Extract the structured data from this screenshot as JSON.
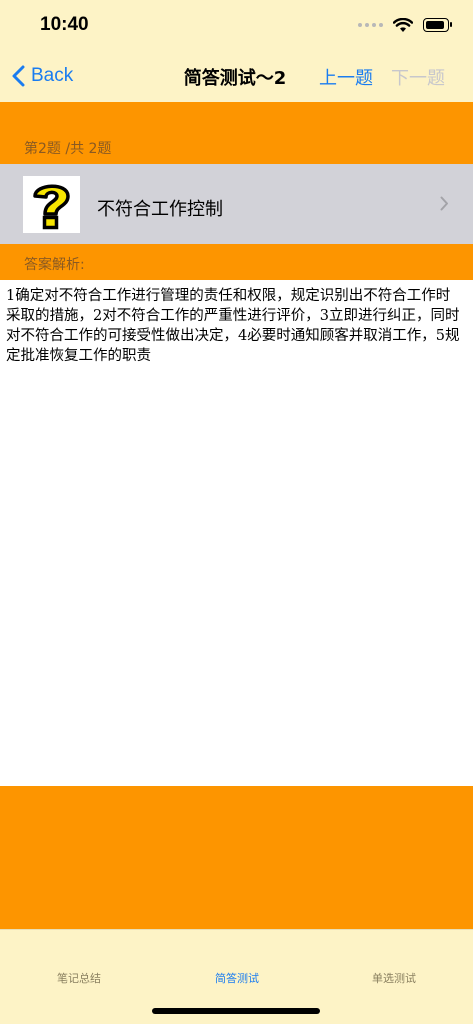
{
  "status_bar": {
    "time": "10:40",
    "icons": [
      "signal-dots-icon",
      "wifi-icon",
      "battery-icon"
    ]
  },
  "nav": {
    "back_label": "Back",
    "title": "简答测试～2",
    "prev_label": "上一题",
    "next_label": "下一题"
  },
  "question": {
    "counter": "第2题 /共 2题",
    "title": "不符合工作控制",
    "icon": "question-mark-icon"
  },
  "answer": {
    "label": "答案解析:",
    "text": "1确定对不符合工作进行管理的责任和权限，规定识别出不符合工作时采取的措施，2对不符合工作的严重性进行评价，3立即进行纠正，同时对不符合工作的可接受性做出决定，4必要时通知顾客并取消工作，5规定批准恢复工作的职责"
  },
  "tabs": [
    {
      "label": "笔记总结",
      "active": false
    },
    {
      "label": "简答测试",
      "active": true
    },
    {
      "label": "单选测试",
      "active": false
    }
  ],
  "colors": {
    "accent": "#1a7cf0",
    "orange": "#fd9500",
    "cream": "#fdf3c6",
    "row_gray": "#d2d2d8"
  }
}
